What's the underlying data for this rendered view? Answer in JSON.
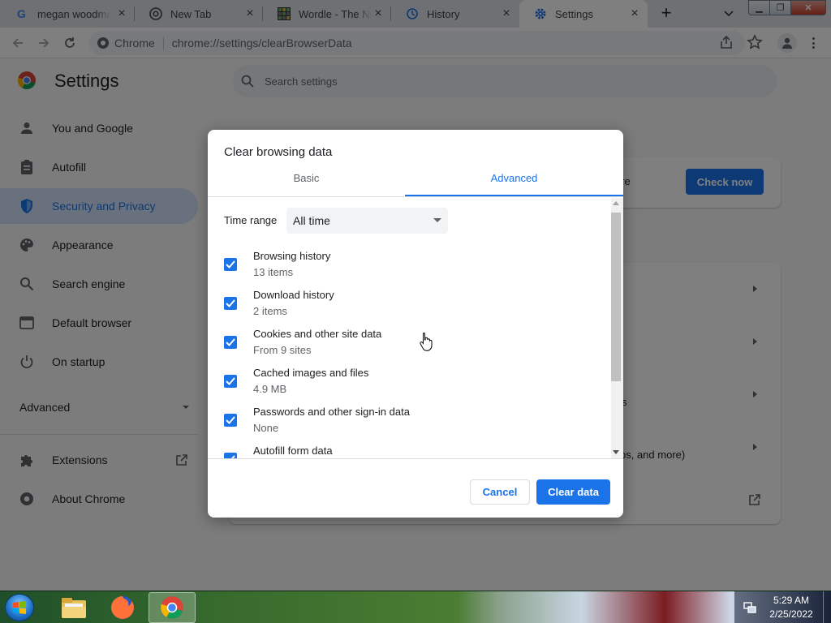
{
  "browser": {
    "tabs": [
      {
        "title": "megan woodman",
        "favicon": "google-icon"
      },
      {
        "title": "New Tab",
        "favicon": "chrome-icon"
      },
      {
        "title": "Wordle - The New",
        "favicon": "wordle-icon"
      },
      {
        "title": "History",
        "favicon": "history-icon"
      },
      {
        "title": "Settings",
        "favicon": "gear-icon",
        "active": true
      }
    ],
    "omnibox": {
      "site_label": "Chrome",
      "url": "chrome://settings/clearBrowserData"
    }
  },
  "settings": {
    "title": "Settings",
    "search_placeholder": "Search settings",
    "sidebar": [
      {
        "label": "You and Google",
        "icon": "person-icon"
      },
      {
        "label": "Autofill",
        "icon": "clipboard-icon"
      },
      {
        "label": "Security and Privacy",
        "icon": "shield-icon",
        "selected": true
      },
      {
        "label": "Appearance",
        "icon": "palette-icon"
      },
      {
        "label": "Search engine",
        "icon": "search-icon"
      },
      {
        "label": "Default browser",
        "icon": "browser-icon"
      },
      {
        "label": "On startup",
        "icon": "power-icon"
      }
    ],
    "advanced_label": "Advanced",
    "extensions_label": "Extensions",
    "about_label": "About Chrome",
    "behind": {
      "check_now": "Check now",
      "partial_more": "ore",
      "partial_s": "s",
      "partial_more2": "ps, and more)"
    }
  },
  "dialog": {
    "title": "Clear browsing data",
    "tabs": {
      "basic": "Basic",
      "advanced": "Advanced"
    },
    "time_range": {
      "label": "Time range",
      "value": "All time"
    },
    "options": [
      {
        "title": "Browsing history",
        "sub": "13 items",
        "checked": true
      },
      {
        "title": "Download history",
        "sub": "2 items",
        "checked": true
      },
      {
        "title": "Cookies and other site data",
        "sub": "From 9 sites",
        "checked": true
      },
      {
        "title": "Cached images and files",
        "sub": "4.9 MB",
        "checked": true
      },
      {
        "title": "Passwords and other sign-in data",
        "sub": "None",
        "checked": true
      },
      {
        "title": "Autofill form data",
        "sub": "",
        "checked": true
      }
    ],
    "cancel": "Cancel",
    "clear": "Clear data"
  },
  "taskbar": {
    "time": "5:29 AM",
    "date": "2/25/2022"
  },
  "colors": {
    "accent": "#1a73e8",
    "selected_bg": "#d2e3fc"
  }
}
